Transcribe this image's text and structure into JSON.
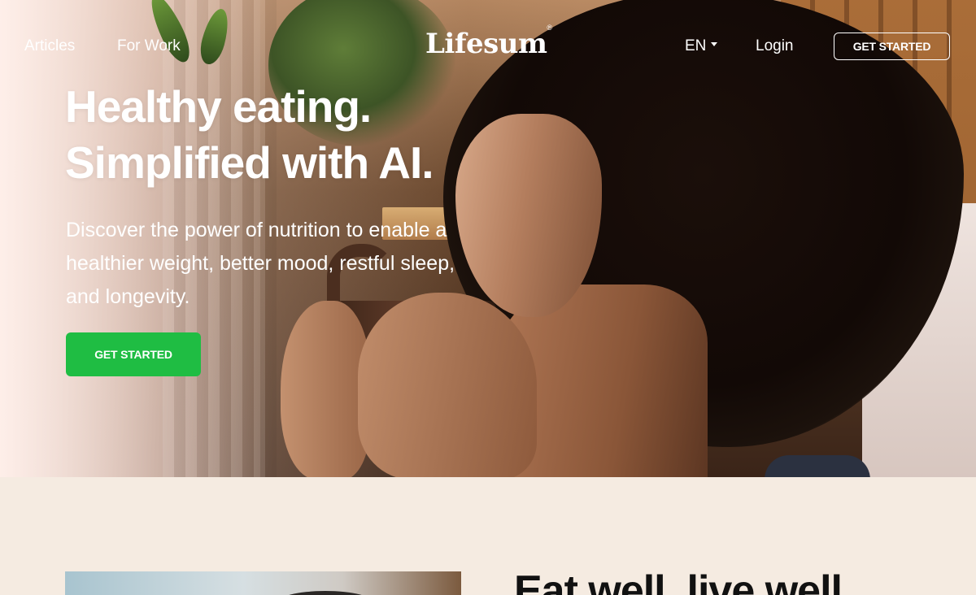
{
  "nav": {
    "links": [
      {
        "label": "Articles"
      },
      {
        "label": "For Work"
      }
    ],
    "logo": "Lifesum",
    "logo_mark": "®",
    "language": "EN",
    "login": "Login",
    "cta": "GET STARTED"
  },
  "hero": {
    "headline_line1": "Healthy eating.",
    "headline_line2": "Simplified with AI.",
    "subtext": "Discover the power of nutrition to enable a healthier weight, better mood, restful sleep, and longevity.",
    "cta": "GET STARTED"
  },
  "section2": {
    "heading": "Eat well, live well"
  },
  "colors": {
    "cta_green": "#1fbd43",
    "section_background": "#f5ebe1",
    "text_white": "#ffffff",
    "heading_dark": "#111111"
  }
}
